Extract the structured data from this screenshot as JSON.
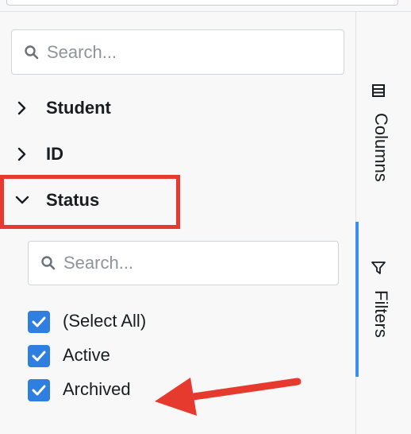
{
  "column_search": {
    "placeholder": "Search..."
  },
  "groups": [
    {
      "label": "Student",
      "expanded": false
    },
    {
      "label": "ID",
      "expanded": false
    },
    {
      "label": "Status",
      "expanded": true
    }
  ],
  "status_filter": {
    "search_placeholder": "Search...",
    "options": [
      {
        "label": "(Select All)",
        "checked": true
      },
      {
        "label": "Active",
        "checked": true
      },
      {
        "label": "Archived",
        "checked": true
      }
    ]
  },
  "side_bar": {
    "tabs": [
      {
        "label": "Columns",
        "icon": "columns-icon",
        "active": false
      },
      {
        "label": "Filters",
        "icon": "filter-icon",
        "active": true
      }
    ]
  },
  "colors": {
    "checkbox": "#2f7fe0",
    "active_tab_indicator": "#3b8fe8",
    "annotation": "#e63a2e"
  }
}
